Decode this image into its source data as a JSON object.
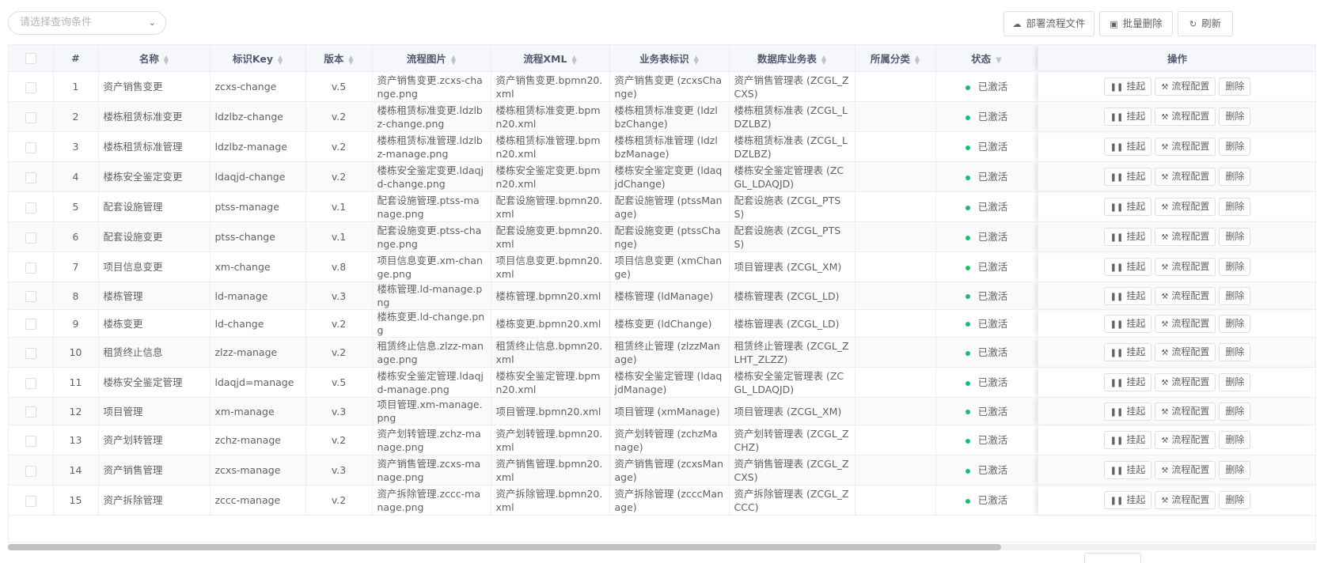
{
  "toolbar": {
    "query_placeholder": "请选择查询条件",
    "deploy_label": "部署流程文件",
    "batch_delete_label": "批量删除",
    "refresh_label": "刷新"
  },
  "table": {
    "headers": {
      "index": "#",
      "name": "名称",
      "key": "标识Key",
      "version": "版本",
      "image": "流程图片",
      "xml": "流程XML",
      "biz_id": "业务表标识",
      "db_table": "数据库业务表",
      "category": "所属分类",
      "status": "状态",
      "ops": "操作"
    },
    "op_labels": {
      "suspend": "挂起",
      "config": "流程配置",
      "delete": "删除"
    },
    "rows": [
      {
        "index": "1",
        "name": "资产销售变更",
        "key": "zcxs-change",
        "version": "v.5",
        "image": "资产销售变更.zcxs-change.png",
        "xml": "资产销售变更.bpmn20.xml",
        "biz_id": "资产销售变更 (zcxsChange)",
        "db_table": "资产销售管理表 (ZCGL_ZCXS)",
        "category": "",
        "status": "已激活"
      },
      {
        "index": "2",
        "name": "楼栋租赁标准变更",
        "key": "ldzlbz-change",
        "version": "v.2",
        "image": "楼栋租赁标准变更.ldzlbz-change.png",
        "xml": "楼栋租赁标准变更.bpmn20.xml",
        "biz_id": "楼栋租赁标准变更 (ldzlbzChange)",
        "db_table": "楼栋租赁标准表 (ZCGL_LDZLBZ)",
        "category": "",
        "status": "已激活"
      },
      {
        "index": "3",
        "name": "楼栋租赁标准管理",
        "key": "ldzlbz-manage",
        "version": "v.2",
        "image": "楼栋租赁标准管理.ldzlbz-manage.png",
        "xml": "楼栋租赁标准管理.bpmn20.xml",
        "biz_id": "楼栋租赁标准管理 (ldzlbzManage)",
        "db_table": "楼栋租赁标准表 (ZCGL_LDZLBZ)",
        "category": "",
        "status": "已激活"
      },
      {
        "index": "4",
        "name": "楼栋安全鉴定变更",
        "key": "ldaqjd-change",
        "version": "v.2",
        "image": "楼栋安全鉴定变更.ldaqjd-change.png",
        "xml": "楼栋安全鉴定变更.bpmn20.xml",
        "biz_id": "楼栋安全鉴定变更 (ldaqjdChange)",
        "db_table": "楼栋安全鉴定管理表 (ZCGL_LDAQJD)",
        "category": "",
        "status": "已激活"
      },
      {
        "index": "5",
        "name": "配套设施管理",
        "key": "ptss-manage",
        "version": "v.1",
        "image": "配套设施管理.ptss-manage.png",
        "xml": "配套设施管理.bpmn20.xml",
        "biz_id": "配套设施管理 (ptssManage)",
        "db_table": "配套设施表 (ZCGL_PTSS)",
        "category": "",
        "status": "已激活"
      },
      {
        "index": "6",
        "name": "配套设施变更",
        "key": "ptss-change",
        "version": "v.1",
        "image": "配套设施变更.ptss-change.png",
        "xml": "配套设施变更.bpmn20.xml",
        "biz_id": "配套设施变更 (ptssChange)",
        "db_table": "配套设施表 (ZCGL_PTSS)",
        "category": "",
        "status": "已激活"
      },
      {
        "index": "7",
        "name": "项目信息变更",
        "key": "xm-change",
        "version": "v.8",
        "image": "项目信息变更.xm-change.png",
        "xml": "项目信息变更.bpmn20.xml",
        "biz_id": "项目信息变更 (xmChange)",
        "db_table": "项目管理表 (ZCGL_XM)",
        "category": "",
        "status": "已激活"
      },
      {
        "index": "8",
        "name": "楼栋管理",
        "key": "ld-manage",
        "version": "v.3",
        "image": "楼栋管理.ld-manage.png",
        "xml": "楼栋管理.bpmn20.xml",
        "biz_id": "楼栋管理 (ldManage)",
        "db_table": "楼栋管理表 (ZCGL_LD)",
        "category": "",
        "status": "已激活"
      },
      {
        "index": "9",
        "name": "楼栋变更",
        "key": "ld-change",
        "version": "v.2",
        "image": "楼栋变更.ld-change.png",
        "xml": "楼栋变更.bpmn20.xml",
        "biz_id": "楼栋变更 (ldChange)",
        "db_table": "楼栋管理表 (ZCGL_LD)",
        "category": "",
        "status": "已激活"
      },
      {
        "index": "10",
        "name": "租赁终止信息",
        "key": "zlzz-manage",
        "version": "v.2",
        "image": "租赁终止信息.zlzz-manage.png",
        "xml": "租赁终止信息.bpmn20.xml",
        "biz_id": "租赁终止管理 (zlzzManage)",
        "db_table": "租赁终止管理表 (ZCGL_ZLHT_ZLZZ)",
        "category": "",
        "status": "已激活"
      },
      {
        "index": "11",
        "name": "楼栋安全鉴定管理",
        "key": "ldaqjd=manage",
        "version": "v.5",
        "image": "楼栋安全鉴定管理.ldaqjd-manage.png",
        "xml": "楼栋安全鉴定管理.bpmn20.xml",
        "biz_id": "楼栋安全鉴定管理 (ldaqjdManage)",
        "db_table": "楼栋安全鉴定管理表 (ZCGL_LDAQJD)",
        "category": "",
        "status": "已激活"
      },
      {
        "index": "12",
        "name": "项目管理",
        "key": "xm-manage",
        "version": "v.3",
        "image": "项目管理.xm-manage.png",
        "xml": "项目管理.bpmn20.xml",
        "biz_id": "项目管理 (xmManage)",
        "db_table": "项目管理表 (ZCGL_XM)",
        "category": "",
        "status": "已激活"
      },
      {
        "index": "13",
        "name": "资产划转管理",
        "key": "zchz-manage",
        "version": "v.2",
        "image": "资产划转管理.zchz-manage.png",
        "xml": "资产划转管理.bpmn20.xml",
        "biz_id": "资产划转管理 (zchzManage)",
        "db_table": "资产划转管理表 (ZCGL_ZCHZ)",
        "category": "",
        "status": "已激活"
      },
      {
        "index": "14",
        "name": "资产销售管理",
        "key": "zcxs-manage",
        "version": "v.3",
        "image": "资产销售管理.zcxs-manage.png",
        "xml": "资产销售管理.bpmn20.xml",
        "biz_id": "资产销售管理 (zcxsManage)",
        "db_table": "资产销售管理表 (ZCGL_ZCXS)",
        "category": "",
        "status": "已激活"
      },
      {
        "index": "15",
        "name": "资产拆除管理",
        "key": "zccc-manage",
        "version": "v.2",
        "image": "资产拆除管理.zccc-manage.png",
        "xml": "资产拆除管理.bpmn20.xml",
        "biz_id": "资产拆除管理 (zcccManage)",
        "db_table": "资产拆除管理表 (ZCGL_ZCCC)",
        "category": "",
        "status": "已激活"
      }
    ]
  },
  "colors": {
    "status_active": "#19be6b",
    "border": "#dcdfe6",
    "header_bg": "#f5f7fa"
  }
}
